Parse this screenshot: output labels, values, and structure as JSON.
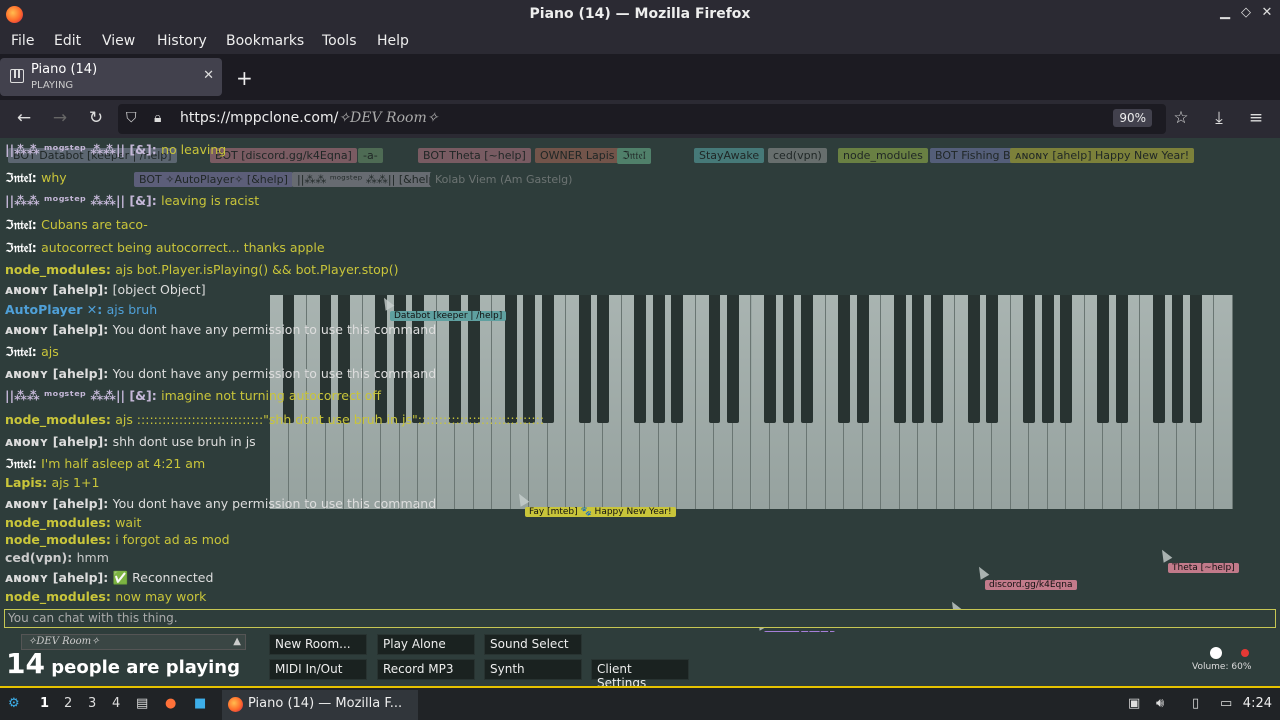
{
  "window": {
    "title": "Piano (14) — Mozilla Firefox"
  },
  "menu": [
    "File",
    "Edit",
    "View",
    "History",
    "Bookmarks",
    "Tools",
    "Help"
  ],
  "tab": {
    "title": "Piano (14)",
    "subtitle": "PLAYING"
  },
  "url": {
    "prefix": "https://mppclone.com/",
    "room": "✧DEV Room✧",
    "zoom": "90%"
  },
  "top_users": [
    {
      "label": "BOT Databot [keeper | /help]",
      "color": "#8a8fa8"
    },
    {
      "label": "BOT [discord.gg/k4Eqna]",
      "color": "#c57a8a"
    },
    {
      "label": "-a-",
      "color": "#6e9a6e"
    },
    {
      "label": "BOT Theta [~help]",
      "color": "#c27a8a"
    },
    {
      "label": "OWNER Lapis",
      "color": "#b56b5a"
    },
    {
      "label": "ℑ𝔫𝔱𝔢𝔩",
      "color": "#73c29a"
    },
    {
      "label": "StayAwake",
      "color": "#5fb5b5"
    },
    {
      "label": "ced(vpn)",
      "color": "#a0a0a0"
    },
    {
      "label": "node_modules",
      "color": "#a5c24b"
    },
    {
      "label": "BOT Fishing Bot [/help]",
      "color": "#7b7fb8"
    },
    {
      "label": "BOT ✧AutoPlayer✧ [&help]",
      "color": "#8b7fb8"
    },
    {
      "label": "||⁂⁂ ᵐᵒᵍˢᵗᵉᵖ ⁂⁂|| [&help]",
      "color": "#a09aa8"
    },
    {
      "label": "Kolab Viem (Am Gastelg)",
      "color": "#2e3d3b"
    },
    {
      "label": "ᴀɴᴏɴʏ [ahelp]  Happy New Year!",
      "color": "#c9c53a"
    }
  ],
  "chat": [
    {
      "name": "||⁂⁂ ᵐᵒᵍˢᵗᵉᵖ ⁂⁂|| [&]:",
      "text": "no leaving",
      "name_color": "#c5b8d8",
      "text_color": "#c9c53a"
    },
    {
      "name": "ℑ𝔫𝔱𝔢𝔩:",
      "text": "why",
      "name_color": "#fff",
      "text_color": "#c9c53a"
    },
    {
      "name": "||⁂⁂ ᵐᵒᵍˢᵗᵉᵖ ⁂⁂|| [&]:",
      "text": "leaving is racist",
      "name_color": "#c5b8d8",
      "text_color": "#c9c53a"
    },
    {
      "name": "ℑ𝔫𝔱𝔢𝔩:",
      "text": "Cubans are taco-",
      "name_color": "#fff",
      "text_color": "#c9c53a"
    },
    {
      "name": "ℑ𝔫𝔱𝔢𝔩:",
      "text": "autocorrect being autocorrect... thanks apple",
      "name_color": "#fff",
      "text_color": "#c9c53a"
    },
    {
      "name": "node_modules:",
      "text": "ajs bot.Player.isPlaying() && bot.Player.stop()",
      "name_color": "#c9c53a",
      "text_color": "#c9c53a"
    },
    {
      "name": "ᴀɴᴏɴʏ [ahelp]:",
      "text": "[object Object]",
      "name_color": "#ddd",
      "text_color": "#ddd"
    },
    {
      "name": "AutoPlayer ✕:",
      "text": "ajs bruh",
      "name_color": "#4fa0d8",
      "text_color": "#4fa0d8"
    },
    {
      "name": "ᴀɴᴏɴʏ [ahelp]:",
      "text": "You dont have any permission to use this command",
      "name_color": "#ddd",
      "text_color": "#ddd"
    },
    {
      "name": "ℑ𝔫𝔱𝔢𝔩:",
      "text": "ajs",
      "name_color": "#fff",
      "text_color": "#c9c53a"
    },
    {
      "name": "ᴀɴᴏɴʏ [ahelp]:",
      "text": "You dont have any permission to use this command",
      "name_color": "#ddd",
      "text_color": "#ddd"
    },
    {
      "name": "||⁂⁂ ᵐᵒᵍˢᵗᵉᵖ ⁂⁂|| [&]:",
      "text": "imagine not turning autocorrect off",
      "name_color": "#c5b8d8",
      "text_color": "#c9c53a"
    },
    {
      "name": "node_modules:",
      "text": "ajs ::::::::::::::::::::::::::::::\"shh dont use bruh in js\"::::::::::::::::::::::::::::::",
      "name_color": "#c9c53a",
      "text_color": "#c9c53a"
    },
    {
      "name": "ᴀɴᴏɴʏ [ahelp]:",
      "text": "shh dont use bruh in js",
      "name_color": "#ddd",
      "text_color": "#ddd"
    },
    {
      "name": "ℑ𝔫𝔱𝔢𝔩:",
      "text": "I'm half asleep at 4:21 am",
      "name_color": "#fff",
      "text_color": "#c9c53a"
    },
    {
      "name": "Lapis:",
      "text": "ajs 1+1",
      "name_color": "#c9c53a",
      "text_color": "#c9c53a"
    },
    {
      "name": "ᴀɴᴏɴʏ [ahelp]:",
      "text": "You dont have any permission to use this command",
      "name_color": "#ddd",
      "text_color": "#ddd"
    },
    {
      "name": "node_modules:",
      "text": "wait",
      "name_color": "#c9c53a",
      "text_color": "#c9c53a"
    },
    {
      "name": "node_modules:",
      "text": "i forgot ad as mod",
      "name_color": "#c9c53a",
      "text_color": "#c9c53a"
    },
    {
      "name": "ced(vpn):",
      "text": "hmm",
      "name_color": "#ccc",
      "text_color": "#ccc"
    },
    {
      "name": "ᴀɴᴏɴʏ [ahelp]:",
      "text": "✅ Reconnected",
      "name_color": "#ddd",
      "text_color": "#ddd"
    },
    {
      "name": "node_modules:",
      "text": "now may work",
      "name_color": "#c9c53a",
      "text_color": "#c9c53a"
    }
  ],
  "chat_input": {
    "placeholder": "You can chat with this thing."
  },
  "bottom": {
    "room": "✧DEV Room✧",
    "people_count": "14",
    "people_label": "people are playing",
    "buttons": [
      "New Room...",
      "Play Alone",
      "Sound Select",
      "MIDI In/Out",
      "Record MP3",
      "Synth",
      "Client Settings"
    ],
    "volume": "Volume: 60%"
  },
  "cursor_tags": [
    {
      "label": "Databot [keeper | /help]",
      "color": "#5fa0a0"
    },
    {
      "label": "Fay [mteb] 🐾 Happy New Year!",
      "color": "#c9c53a"
    },
    {
      "label": "discord.gg/k4Eqna",
      "color": "#c27a8a"
    },
    {
      "label": "Theta [~help]",
      "color": "#c27a8a"
    },
    {
      "label": "StayAwake",
      "color": "#5fb5b5"
    },
    {
      "label": "node_modules",
      "color": "#c9e53a"
    },
    {
      "label": "ced(vpn)",
      "color": "#c9c53a"
    },
    {
      "label": "ᴀɴᴏɴʏ [ahelp]",
      "color": "#a57fd8"
    },
    {
      "label": "||⁂⁂ ᵐᵒᵍˢᵗᵉᵖ ⁂⁂|| [&]",
      "color": "#b57fe8"
    },
    {
      "label": "ℑ𝔫𝔱𝔢𝔩",
      "color": "#73e29a"
    }
  ],
  "taskbar": {
    "desktops": [
      "1",
      "2",
      "3",
      "4"
    ],
    "task": "Piano (14) — Mozilla F...",
    "clock": "4:24"
  }
}
